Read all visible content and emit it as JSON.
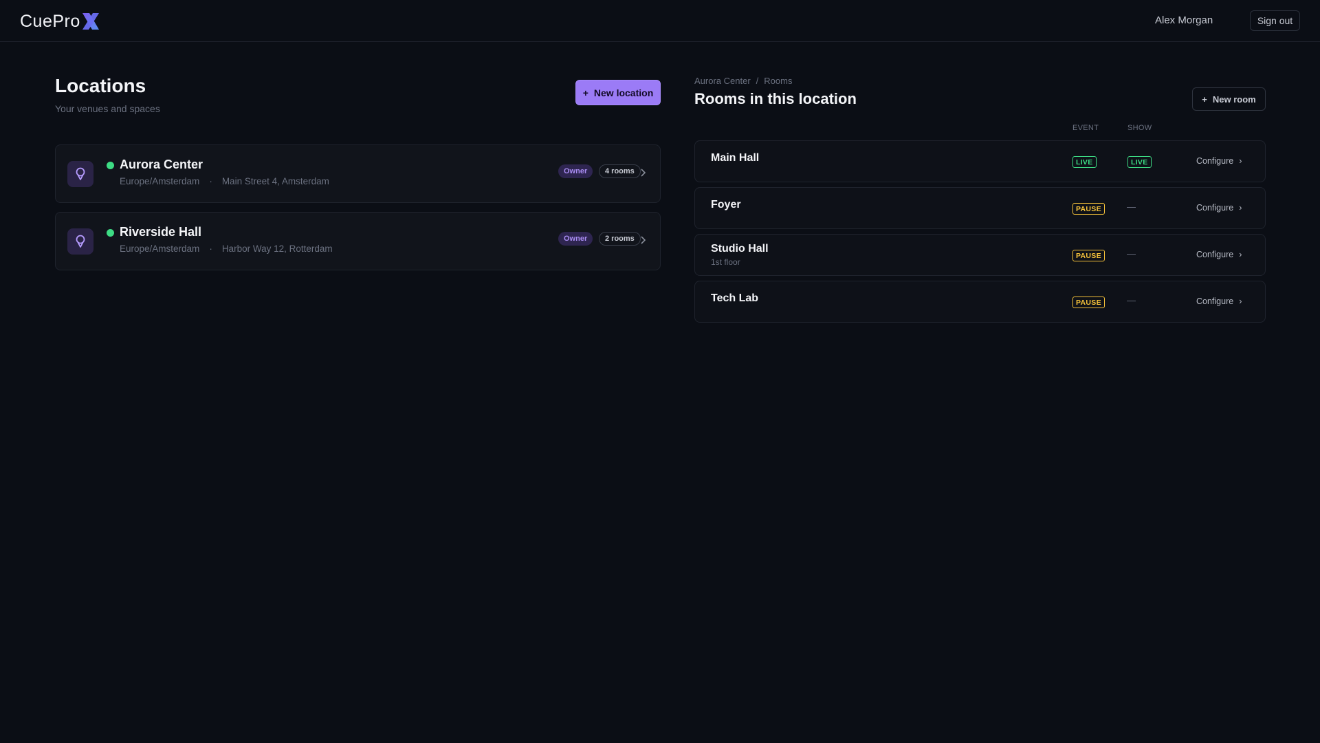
{
  "app": {
    "logo_text": "CuePro",
    "logo_mark": "X",
    "user_name": "Alex Morgan",
    "sign_out_label": "Sign out"
  },
  "locations": {
    "title": "Locations",
    "subtitle": "Your venues and spaces",
    "new_button_label": "New location",
    "new_button_icon": "+",
    "items": [
      {
        "name": "Aurora Center",
        "timezone": "Europe/Amsterdam",
        "separator": "·",
        "address": "Main Street 4, Amsterdam",
        "role": "Owner",
        "rooms_label": "4 rooms",
        "status": "online"
      },
      {
        "name": "Riverside Hall",
        "timezone": "Europe/Amsterdam",
        "separator": "·",
        "address": "Harbor Way 12, Rotterdam",
        "role": "Owner",
        "rooms_label": "2 rooms",
        "status": "online"
      }
    ]
  },
  "rooms": {
    "breadcrumb": [
      "Aurora Center",
      "Rooms"
    ],
    "breadcrumb_separator": "/",
    "title": "Rooms in this location",
    "new_button_label": "New room",
    "new_button_icon": "+",
    "columns": {
      "event": "EVENT",
      "show": "SHOW"
    },
    "configure_label": "Configure",
    "configure_chevron": "›",
    "empty_value": "—",
    "items": [
      {
        "name": "Main Hall",
        "subtitle": "",
        "event": "LIVE",
        "show": "LIVE"
      },
      {
        "name": "Foyer",
        "subtitle": "",
        "event": "PAUSE",
        "show": "—"
      },
      {
        "name": "Studio Hall",
        "subtitle": "1st floor",
        "event": "PAUSE",
        "show": "—"
      },
      {
        "name": "Tech Lab",
        "subtitle": "",
        "event": "PAUSE",
        "show": "—"
      }
    ]
  },
  "colors": {
    "background": "#0b0e15",
    "accent": "#9b7bf6",
    "live": "#3ddc84",
    "pause": "#f5c23a"
  },
  "icons": {
    "location": "map-pin-icon",
    "chevron": "chevron-right-icon"
  }
}
